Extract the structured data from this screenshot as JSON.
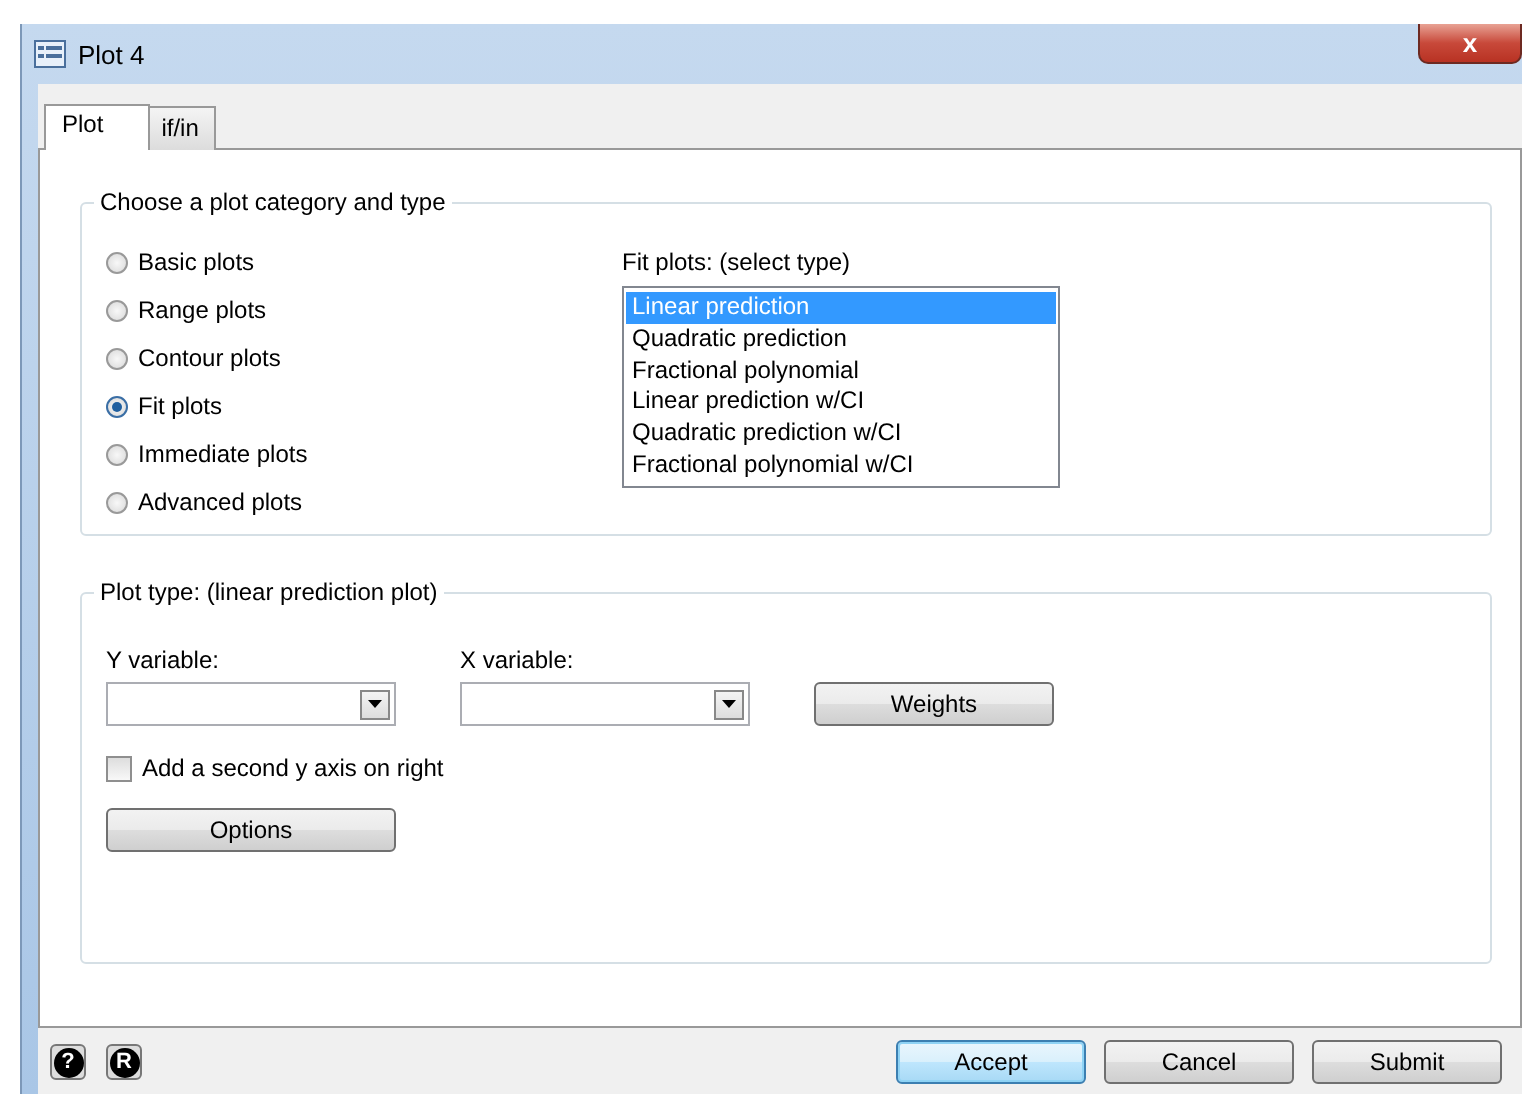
{
  "window": {
    "title": "Plot 4",
    "close": "x"
  },
  "tabs": [
    {
      "label": "Plot",
      "selected": true
    },
    {
      "label": "if/in",
      "selected": false
    }
  ],
  "category_group": {
    "title": "Choose a plot category and type",
    "categories": [
      {
        "label": "Basic plots",
        "selected": false
      },
      {
        "label": "Range plots",
        "selected": false
      },
      {
        "label": "Contour plots",
        "selected": false
      },
      {
        "label": "Fit plots",
        "selected": true
      },
      {
        "label": "Immediate plots",
        "selected": false
      },
      {
        "label": "Advanced plots",
        "selected": false
      }
    ],
    "type_list_label": "Fit plots: (select type)",
    "types": [
      {
        "label": "Linear prediction",
        "selected": true
      },
      {
        "label": "Quadratic prediction",
        "selected": false
      },
      {
        "label": "Fractional polynomial",
        "selected": false
      },
      {
        "label": "Linear prediction w/CI",
        "selected": false
      },
      {
        "label": "Quadratic prediction w/CI",
        "selected": false
      },
      {
        "label": "Fractional polynomial w/CI",
        "selected": false
      }
    ]
  },
  "plot_type_group": {
    "title": "Plot type: (linear prediction plot)",
    "y_variable_label": "Y variable:",
    "x_variable_label": "X variable:",
    "weights_button": "Weights",
    "second_axis": {
      "label": "Add a second y axis on right",
      "checked": false
    },
    "options_button": "Options"
  },
  "footer": {
    "help_icon": "?",
    "r_icon": "R",
    "buttons": [
      {
        "label": "Accept",
        "kind": "default"
      },
      {
        "label": "Cancel",
        "kind": "normal"
      },
      {
        "label": "Submit",
        "kind": "normal"
      }
    ]
  }
}
